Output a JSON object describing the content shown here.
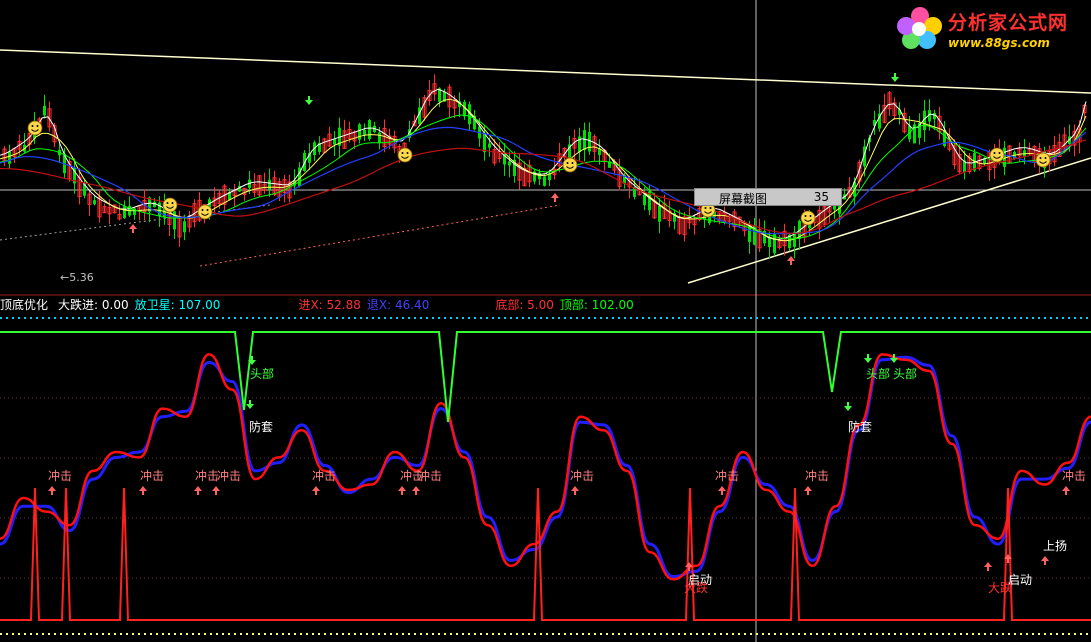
{
  "logo": {
    "title": "分析家公式网",
    "url": "www.88gs.com"
  },
  "price_panel": {
    "low_marker": "←5.36"
  },
  "info_bar": [
    {
      "text": "顶底优化",
      "color": "#ffffff"
    },
    {
      "text": "大跌进: 0.00",
      "color": "#ffffff"
    },
    {
      "text": "放卫星: 107.00",
      "color": "#00ffff"
    },
    {
      "text": "进X: 52.88",
      "color": "#ff3030"
    },
    {
      "text": "退X: 46.40",
      "color": "#4040ff"
    },
    {
      "text": "底部: 5.00",
      "color": "#ff3030"
    },
    {
      "text": "顶部: 102.00",
      "color": "#00ff00"
    }
  ],
  "tooltip": {
    "label": "屏幕截图",
    "value": "35"
  },
  "annotations": {
    "chongji": "冲击",
    "toubu": "头部",
    "fangtao": "防套",
    "qidong": "启动",
    "dadie": "大跌",
    "shangyang": "上扬"
  },
  "colors": {
    "background": "#000000",
    "up_candle": "#ff3030",
    "down_candle": "#00e000",
    "ma_white": "#ffffff",
    "ma_yellow": "#ffff60",
    "ma_green": "#00ff00",
    "ma_blue": "#2040ff",
    "ma_red": "#c01010",
    "jin_line": "#ff1010",
    "tui_line": "#2020ff",
    "top_line": "#30ff30",
    "dotted_cyan": "#00d0ff",
    "dotted_yellow": "#ffff80"
  },
  "chart_data": {
    "type": "line",
    "series": [
      {
        "name": "进X",
        "values": [
          30,
          45,
          40,
          35,
          55,
          62,
          60,
          78,
          75,
          98,
          85,
          52,
          60,
          70,
          55,
          48,
          50,
          62,
          55,
          80,
          60,
          35,
          20,
          28,
          40,
          75,
          70,
          55,
          25,
          15,
          20,
          42,
          62,
          48,
          40,
          20,
          42,
          72,
          98,
          96,
          92,
          65,
          35,
          30,
          55,
          50,
          58,
          75
        ]
      },
      {
        "name": "退X",
        "values": [
          28,
          42,
          42,
          33,
          52,
          60,
          62,
          75,
          77,
          95,
          88,
          55,
          58,
          72,
          57,
          47,
          52,
          60,
          57,
          78,
          62,
          38,
          22,
          26,
          38,
          73,
          72,
          57,
          28,
          16,
          18,
          40,
          60,
          50,
          42,
          22,
          40,
          70,
          96,
          97,
          94,
          68,
          38,
          28,
          52,
          52,
          56,
          73
        ]
      }
    ],
    "ylim": [
      0,
      107
    ]
  }
}
